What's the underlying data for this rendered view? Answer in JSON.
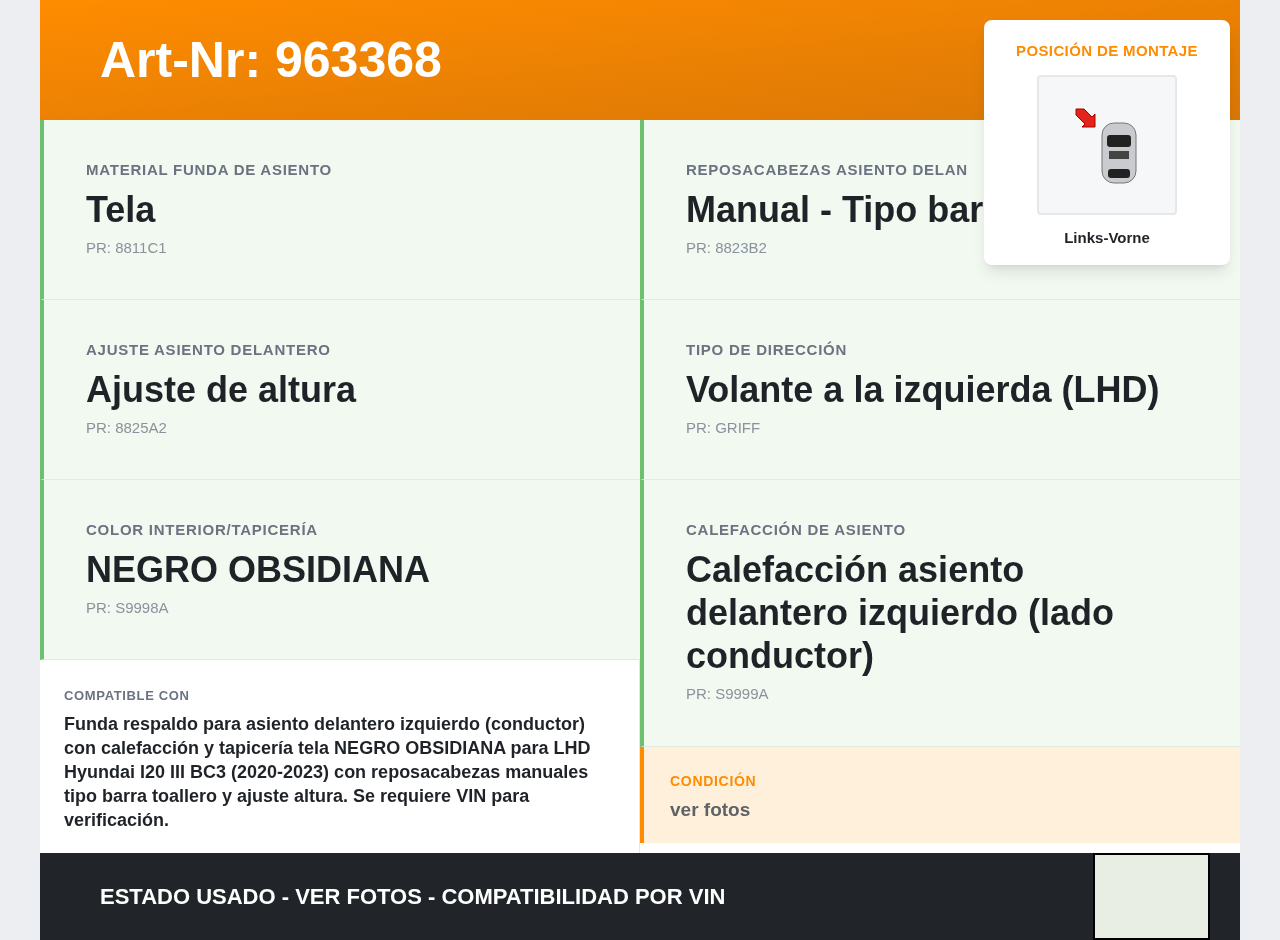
{
  "header": {
    "title": "Art-Nr: 963368"
  },
  "mount_position": {
    "title": "POSICIÓN DE MONTAJE",
    "label": "Links-Vorne"
  },
  "columns": [
    [
      {
        "label": "MATERIAL FUNDA DE ASIENTO",
        "value": "Tela",
        "code": "PR: 8811C1"
      },
      {
        "label": "AJUSTE ASIENTO DELANTERO",
        "value": "Ajuste de altura",
        "code": "PR: 8825A2"
      },
      {
        "label": "COLOR INTERIOR/TAPICERÍA",
        "value": "NEGRO OBSIDIANA",
        "code": "PR: S9998A"
      }
    ],
    [
      {
        "label": "REPOSACABEZAS ASIENTO DELAN",
        "value": "Manual - Tipo bar",
        "code": "PR: 8823B2"
      },
      {
        "label": "TIPO DE DIRECCIÓN",
        "value": "Volante a la izquierda (LHD)",
        "code": "PR: GRIFF"
      },
      {
        "label": "CALEFACCIÓN DE ASIENTO",
        "value": "Calefacción asiento delantero izquierdo (lado conductor)",
        "code": "PR: S9999A"
      }
    ]
  ],
  "compatible": {
    "label": "COMPATIBLE CON",
    "text": "Funda respaldo para asiento delantero izquierdo (conductor) con calefacción y tapicería tela NEGRO OBSIDIANA para LHD Hyundai I20 III BC3 (2020-2023) con reposacabezas manuales tipo barra toallero y ajuste altura. Se requiere VIN para verificación."
  },
  "condition": {
    "label": "CONDICIÓN",
    "text": "ver fotos"
  },
  "footer": {
    "text": "ESTADO USADO - VER FOTOS - COMPATIBILIDAD POR VIN"
  }
}
